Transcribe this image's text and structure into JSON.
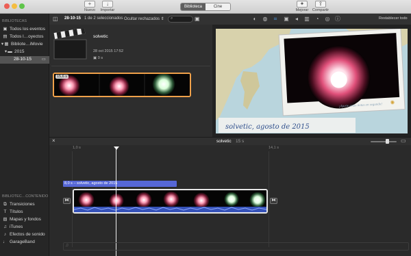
{
  "toolbar": {
    "new_label": "Nuevo",
    "import_label": "Importar",
    "tab_library": "Biblioteca",
    "tab_cinema": "Cine",
    "enhance_label": "Mejorar",
    "share_label": "Compartir"
  },
  "sidebar": {
    "libraries_header": "BIBLIOTECAS",
    "items": [
      {
        "label": "Todos los eventos",
        "icon": "film-icon"
      },
      {
        "label": "Todos l…oyectos",
        "icon": "projects-icon"
      },
      {
        "label": "Bibliote…iMovie",
        "icon": "library-icon"
      },
      {
        "label": "2015",
        "icon": "folder-icon"
      },
      {
        "label": "28-10-15",
        "icon": "event-icon"
      }
    ],
    "content_header": "BIBLIOTEC…CONTENIDO",
    "content_items": [
      {
        "label": "Transiciones",
        "icon": "transitions-icon"
      },
      {
        "label": "Títulos",
        "icon": "titles-icon"
      },
      {
        "label": "Mapas y fondos",
        "icon": "maps-icon"
      },
      {
        "label": "iTunes",
        "icon": "music-icon"
      },
      {
        "label": "Efectos de sonido",
        "icon": "sound-effects-icon"
      },
      {
        "label": "GarageBand",
        "icon": "guitar-icon"
      }
    ]
  },
  "browser": {
    "event_date": "28-10-15",
    "selection": "1 de 2 seleccionados",
    "filter": "Ocultar rechazados",
    "project_name": "solvetic",
    "project_date": "28 oct 2015 17:52",
    "project_duration": "0 s",
    "clip_duration": "15,6 s"
  },
  "viewer": {
    "reset_all": "Restablecer todo",
    "caption": "solvetic, agosto de 2015",
    "map_label": "¡Ajuste estas notas en segundo!"
  },
  "timeline": {
    "project_name": "solvetic",
    "project_duration": "15 s",
    "tick_start": "1,0 s",
    "tick_mid": "14,1 s",
    "title_clip": "8,0 s – solvetic, agosto de 2015"
  },
  "colors": {
    "accent_blue": "#5667d6",
    "clip_border": "#f0a14a",
    "sky": "#b9d5dd"
  }
}
